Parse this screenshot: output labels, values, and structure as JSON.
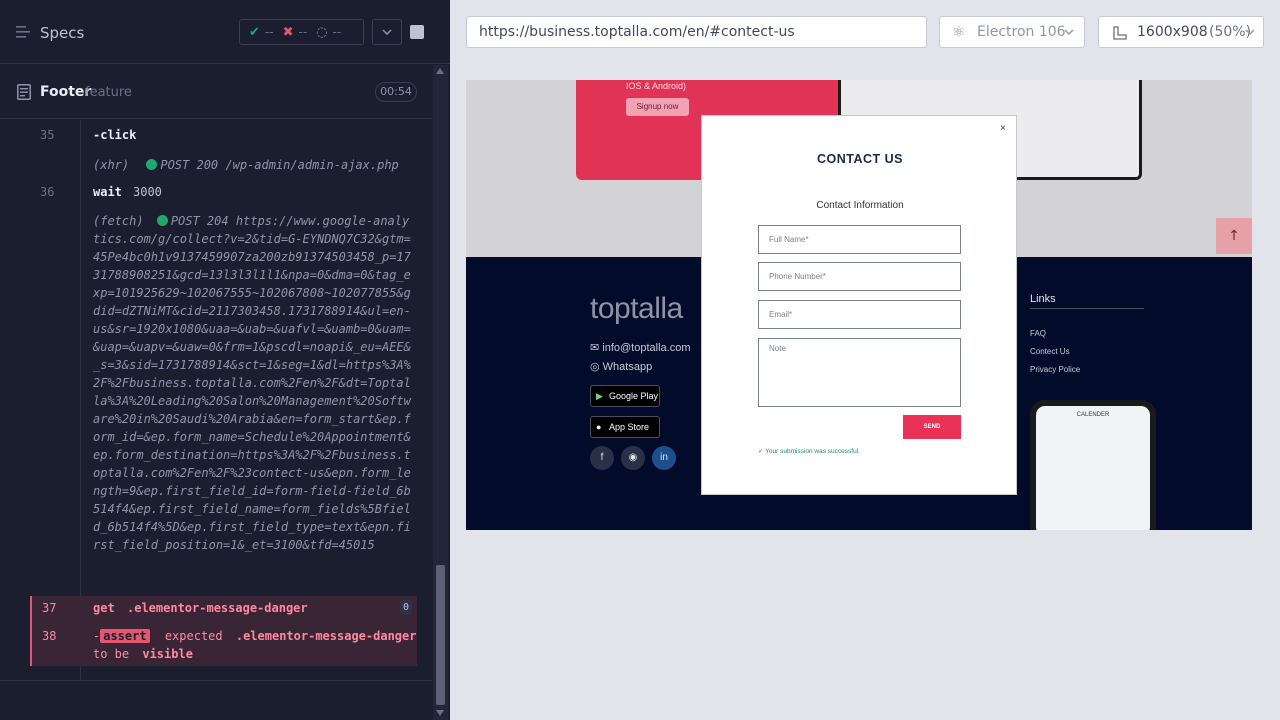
{
  "runner": {
    "specs_label": "Specs",
    "stats": {
      "passed": {
        "icon": "check-icon",
        "value": "--",
        "color": "#1fa971"
      },
      "failed": {
        "icon": "cross-icon",
        "value": "--",
        "color": "#e45770"
      },
      "pending": {
        "icon": "spinner-icon",
        "value": "--",
        "color": "#9095ad"
      }
    },
    "spec": {
      "name": "Footer",
      "kind": "feature",
      "duration": "00:54"
    },
    "commands": [
      {
        "line": "35",
        "name": "-click"
      },
      {
        "xhr_kind": "(xhr)",
        "xhr_text": "POST 200 /wp-admin/admin-ajax.php"
      },
      {
        "line": "36",
        "name": "wait",
        "arg": "3000"
      },
      {
        "fetch_kind": "(fetch)",
        "fetch_text": "POST 204 https://www.google-analytics.com/g/collect?v=2&tid=G-EYNDNQ7C32&gtm=45Pe4bc0h1v9137459907za200zb91374503458_p=1731788908251&gcd=13l3l3l1l1&npa=0&dma=0&tag_exp=101925629~102067555~102067808~102077855&gdid=dZTNiMT&cid=2117303458.1731788914&ul=en-us&sr=1920x1080&uaa=&uab=&uafvl=&uamb=0&uam=&uap=&uapv=&uaw=0&frm=1&pscdl=noapi&_eu=AEE&_s=3&sid=1731788914&sct=1&seg=1&dl=https%3A%2F%2Fbusiness.toptalla.com%2Fen%2F&dt=Toptalla%3A%20Leading%20Salon%20Management%20Software%20in%20Saudi%20Arabia&en=form_start&ep.form_id=&ep.form_name=Schedule%20Appointment&ep.form_destination=https%3A%2F%2Fbusiness.toptalla.com%2Fen%2F%23contect-us&epn.form_length=9&ep.first_field_id=form-field-field_6b514f4&ep.first_field_name=form_fields%5Bfield_6b514f4%5D&ep.first_field_type=text&epn.first_field_position=1&_et=3100&tfd=45015"
      },
      {
        "line": "37",
        "name": "get",
        "arg": ".elementor-message-danger",
        "count": "0"
      },
      {
        "line": "38",
        "name": "-",
        "badge": "assert",
        "text1": "expected",
        "selector": ".elementor-message-danger",
        "text2": "to be",
        "text3": "visible"
      }
    ]
  },
  "aut": {
    "url": "https://business.toptalla.com/en/#contect-us",
    "browser": "Electron 106",
    "viewport": "1600x908",
    "scale": "(50%)"
  },
  "site": {
    "app_text": "IOS & Android)",
    "signup": "Signup now",
    "logo": "toptalla",
    "email": "info@toptalla.com",
    "whatsapp": "Whatsapp",
    "google_play": "Google Play",
    "app_store": "App Store",
    "links_title": "Links",
    "links": [
      "FAQ",
      "Contect Us",
      "Privacy Police"
    ],
    "phone_title": "CALENDER",
    "modal": {
      "close": "×",
      "title": "CONTACT US",
      "subtitle": "Contact Information",
      "fields": [
        "Full Name*",
        "Phone Number*",
        "Email*"
      ],
      "note": "Note",
      "send": "SEND",
      "success": "Your submission was successful."
    }
  }
}
